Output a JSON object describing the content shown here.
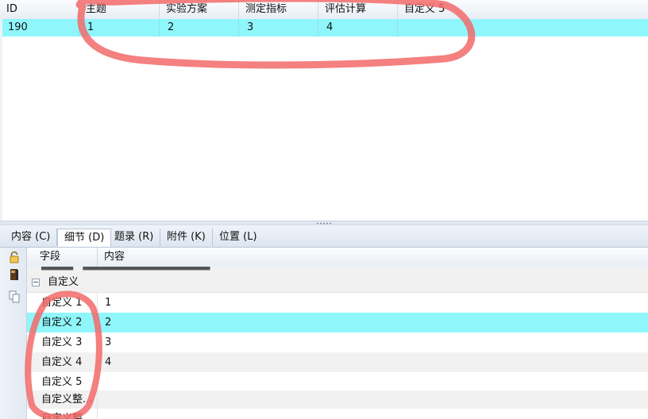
{
  "top_grid": {
    "columns": [
      {
        "label": "ID"
      },
      {
        "label": "主题"
      },
      {
        "label": "实验方案"
      },
      {
        "label": "测定指标"
      },
      {
        "label": "评估计算"
      },
      {
        "label": "自定义 5"
      }
    ],
    "row": {
      "id": "190",
      "cells": [
        "1",
        "2",
        "3",
        "4",
        ""
      ]
    }
  },
  "tabs": [
    {
      "label": "内容 (C)"
    },
    {
      "label": "细节 (D)"
    },
    {
      "label": "题录 (R)"
    },
    {
      "label": "附件 (K)"
    },
    {
      "label": "位置 (L)"
    }
  ],
  "toolbar_icons": [
    "lock-icon",
    "book-icon",
    "copy-icon"
  ],
  "property_grid": {
    "headers": {
      "field": "字段",
      "content": "内容"
    },
    "group": {
      "label": "自定义"
    },
    "rows": [
      {
        "key": "自定义 1",
        "value": "1"
      },
      {
        "key": "自定义 2",
        "value": "2"
      },
      {
        "key": "自定义 3",
        "value": "3"
      },
      {
        "key": "自定义 4",
        "value": "4"
      },
      {
        "key": "自定义 5",
        "value": ""
      },
      {
        "key": "自定义整...",
        "value": ""
      },
      {
        "key": "自定义整",
        "value": ""
      }
    ]
  },
  "colors": {
    "selection": "#8ff7fb",
    "annotation": "#f26a6a"
  }
}
